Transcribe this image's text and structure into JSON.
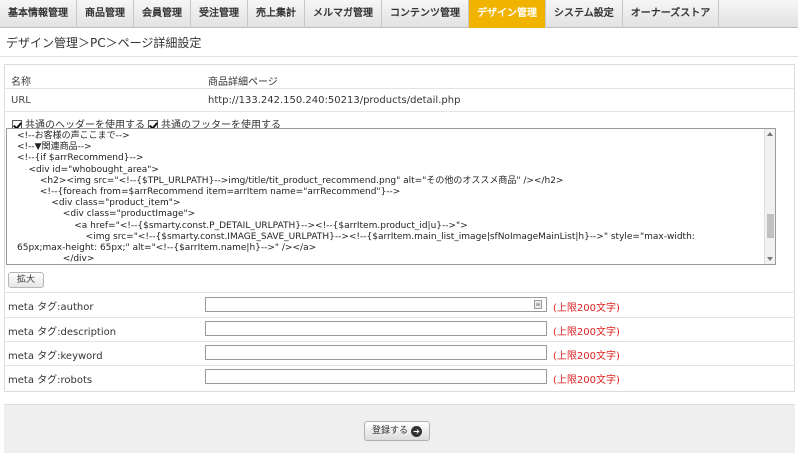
{
  "nav": {
    "tabs": [
      {
        "label": "基本情報管理",
        "active": false
      },
      {
        "label": "商品管理",
        "active": false
      },
      {
        "label": "会員管理",
        "active": false
      },
      {
        "label": "受注管理",
        "active": false
      },
      {
        "label": "売上集計",
        "active": false
      },
      {
        "label": "メルマガ管理",
        "active": false
      },
      {
        "label": "コンテンツ管理",
        "active": false
      },
      {
        "label": "デザイン管理",
        "active": true
      },
      {
        "label": "システム設定",
        "active": false
      },
      {
        "label": "オーナーズストア",
        "active": false
      }
    ],
    "active_color": "#f0b400"
  },
  "page": {
    "title": "デザイン管理＞PC＞ページ詳細設定"
  },
  "form": {
    "name_label": "名称",
    "name_value": "商品詳細ページ",
    "url_label": "URL",
    "url_value": "http://133.242.150.240:50213/products/detail.php",
    "use_header_label": "共通のヘッダーを使用する",
    "use_footer_label": "共通のフッターを使用する",
    "use_header_checked": true,
    "use_footer_checked": true,
    "editor_lines": [
      "<!--お客様の声ここまで-->",
      "",
      "<!--▼関連商品-->",
      "<!--{if $arrRecommend}-->",
      "    <div id=\"whobought_area\">",
      "        <h2><img src=\"<!--{$TPL_URLPATH}-->img/title/tit_product_recommend.png\" alt=\"その他のオススメ商品\" /></h2>",
      "        <!--{foreach from=$arrRecommend item=arrItem name=\"arrRecommend\"}-->",
      "            <div class=\"product_item\">",
      "                <div class=\"productImage\">",
      "                    <a href=\"<!--{$smarty.const.P_DETAIL_URLPATH}--><!--{$arrItem.product_id|u}-->\">",
      "                        <img src=\"<!--{$smarty.const.IMAGE_SAVE_URLPATH}--><!--{$arrItem.main_list_image|sfNoImageMainList|h}-->\" style=\"max-width:",
      "65px;max-height: 65px;\" alt=\"<!--{$arrItem.name|h}-->\" /></a>",
      "                </div>"
    ],
    "expand_label": "拡大",
    "meta": [
      {
        "label": "meta タグ:author",
        "value": "",
        "limit": "(上限200文字)"
      },
      {
        "label": "meta タグ:description",
        "value": "",
        "limit": "(上限200文字)"
      },
      {
        "label": "meta タグ:keyword",
        "value": "",
        "limit": "(上限200文字)"
      },
      {
        "label": "meta タグ:robots",
        "value": "",
        "limit": "(上限200文字)"
      }
    ],
    "limit_color": "#dd2222"
  },
  "footer": {
    "submit_label": "登録する",
    "submit_icon": "arrow-right-circle-icon"
  }
}
